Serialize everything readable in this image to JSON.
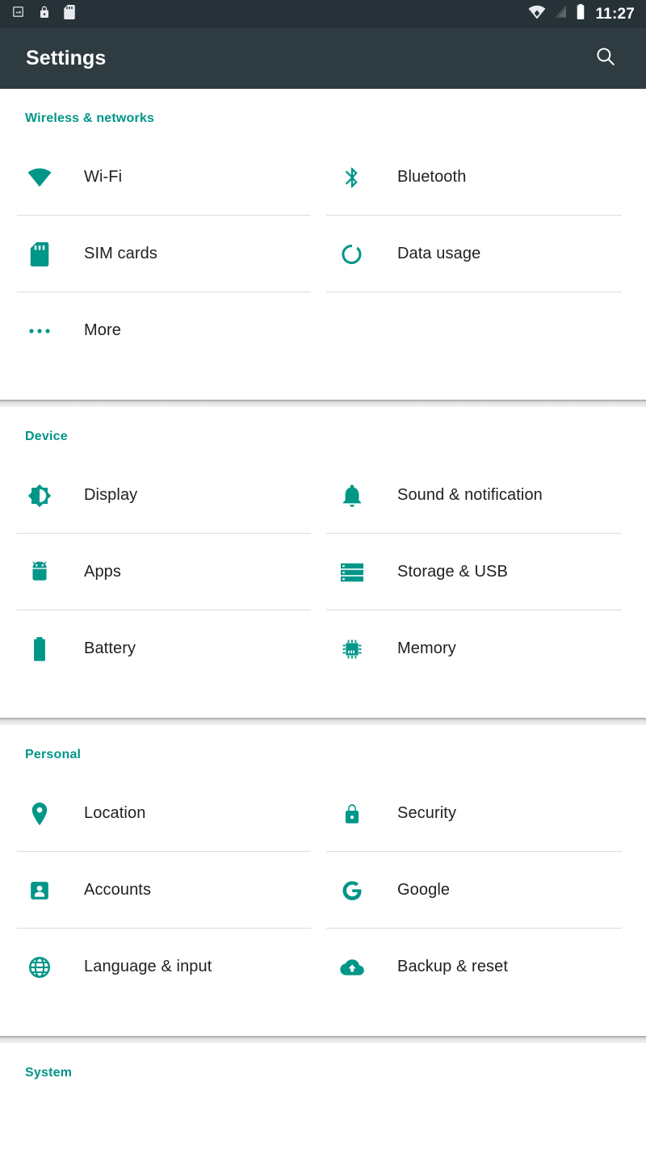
{
  "status_bar": {
    "left_icons": [
      "image-icon",
      "lock-icon",
      "sd-card-icon"
    ],
    "right_icons": [
      "wifi-no-internet-icon",
      "no-sim-signal-icon",
      "battery-icon"
    ],
    "clock": "11:27"
  },
  "app_bar": {
    "title": "Settings",
    "search_icon": "search-icon"
  },
  "colors": {
    "accent": "#009688",
    "app_bar": "#2e3b41",
    "status_bar": "#263238",
    "label_text": "#212121",
    "divider": "#dcdcdc"
  },
  "sections": [
    {
      "header": "Wireless & networks",
      "items": [
        {
          "label": "Wi-Fi",
          "icon": "wifi-icon"
        },
        {
          "label": "Bluetooth",
          "icon": "bluetooth-icon"
        },
        {
          "label": "SIM cards",
          "icon": "sim-card-icon"
        },
        {
          "label": "Data usage",
          "icon": "data-usage-icon"
        },
        {
          "label": "More",
          "icon": "more-dots-icon"
        }
      ]
    },
    {
      "header": "Device",
      "items": [
        {
          "label": "Display",
          "icon": "brightness-icon"
        },
        {
          "label": "Sound & notification",
          "icon": "bell-icon"
        },
        {
          "label": "Apps",
          "icon": "android-icon"
        },
        {
          "label": "Storage & USB",
          "icon": "storage-icon"
        },
        {
          "label": "Battery",
          "icon": "battery-icon"
        },
        {
          "label": "Memory",
          "icon": "memory-chip-icon"
        }
      ]
    },
    {
      "header": "Personal",
      "items": [
        {
          "label": "Location",
          "icon": "location-pin-icon"
        },
        {
          "label": "Security",
          "icon": "lock-icon"
        },
        {
          "label": "Accounts",
          "icon": "account-icon"
        },
        {
          "label": "Google",
          "icon": "google-g-icon"
        },
        {
          "label": "Language & input",
          "icon": "globe-icon"
        },
        {
          "label": "Backup & reset",
          "icon": "cloud-upload-icon"
        }
      ]
    },
    {
      "header": "System",
      "items": []
    }
  ]
}
